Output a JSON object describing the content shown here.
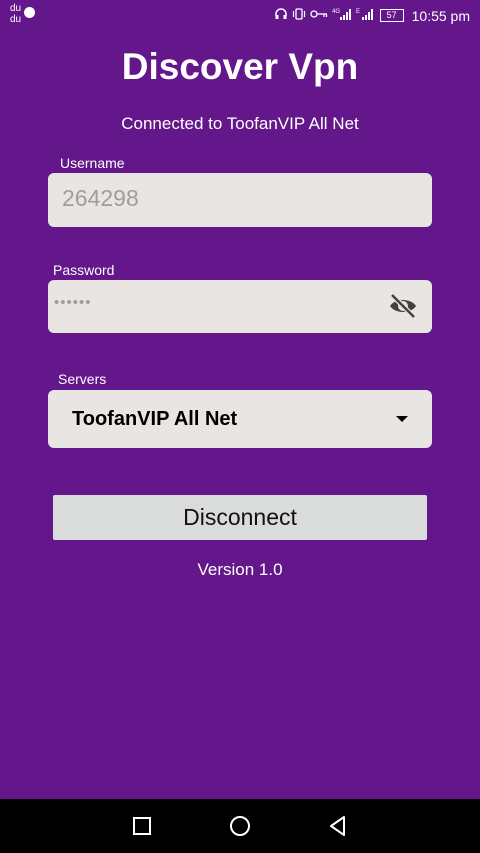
{
  "status_bar": {
    "left_text": "du\ndu",
    "battery": "57",
    "time": "10:55 pm",
    "icons": [
      "headset-icon",
      "vibrate-icon",
      "vpn-key-icon",
      "signal-4g-icon",
      "signal-e-icon",
      "battery-icon"
    ]
  },
  "app": {
    "title": "Discover Vpn",
    "connection_status": "Connected to ToofanVIP All Net",
    "version": "Version 1.0"
  },
  "form": {
    "username_label": "Username",
    "username_value": "264298",
    "password_label": "Password",
    "password_value": "••••••",
    "servers_label": "Servers",
    "selected_server": "ToofanVIP All Net",
    "disconnect_label": "Disconnect"
  },
  "colors": {
    "background": "#64178a",
    "field_background": "#e8e5e3",
    "button_background": "#dadcdc"
  },
  "nav": {
    "icons": [
      "recent-apps-icon",
      "home-icon",
      "back-icon"
    ]
  }
}
